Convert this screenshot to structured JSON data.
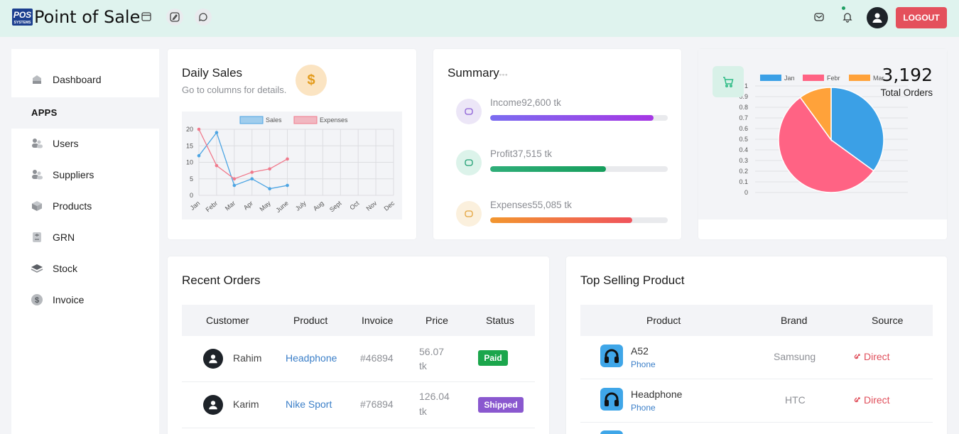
{
  "header": {
    "title": "Point of Sale",
    "logo_text": "POS",
    "logo_sub": "SYSTEMS",
    "logout_label": "LOGOUT",
    "icons": [
      "calendar-icon",
      "edit-icon",
      "chat-icon",
      "mail-icon",
      "bell-icon",
      "user-icon"
    ]
  },
  "sidebar": {
    "items": [
      {
        "label": "Dashboard",
        "icon": "dashboard-icon"
      },
      {
        "label": "Users",
        "icon": "users-icon"
      },
      {
        "label": "Suppliers",
        "icon": "suppliers-icon"
      },
      {
        "label": "Products",
        "icon": "box-icon"
      },
      {
        "label": "GRN",
        "icon": "grn-icon"
      },
      {
        "label": "Stock",
        "icon": "layers-icon"
      },
      {
        "label": "Invoice",
        "icon": "dollar-icon"
      }
    ],
    "section_title": "APPS"
  },
  "daily_sales": {
    "title": "Daily Sales",
    "subtitle": "Go to columns for details.",
    "badge_icon": "$"
  },
  "summary": {
    "title": "Summary",
    "items": [
      {
        "label": "Income",
        "value": "92,600 tk",
        "progress": 0.92,
        "color_from": "#7b6cf0",
        "color_to": "#a637e4",
        "icon_bg": "#ece6f7",
        "icon_color": "#8a5cd6"
      },
      {
        "label": "Profit",
        "value": "37,515 tk",
        "progress": 0.65,
        "color_from": "#2fae79",
        "color_to": "#169e5c",
        "icon_bg": "#dcf3ea",
        "icon_color": "#1f9e72"
      },
      {
        "label": "Expenses",
        "value": "55,085 tk",
        "progress": 0.8,
        "color_from": "#f2962e",
        "color_to": "#f0535c",
        "icon_bg": "#fbf0dd",
        "icon_color": "#e3a23a"
      }
    ]
  },
  "orders": {
    "total": "3,192",
    "label": "Total Orders"
  },
  "recent_orders": {
    "title": "Recent Orders",
    "columns": [
      "Customer",
      "Product",
      "Invoice",
      "Price",
      "Status"
    ],
    "rows": [
      {
        "customer": "Rahim",
        "product": "Headphone",
        "invoice": "#46894",
        "price_line1": "56.07",
        "price_line2": "tk",
        "status": "Paid",
        "status_color": "#1ba64c"
      },
      {
        "customer": "Karim",
        "product": "Nike Sport",
        "invoice": "#76894",
        "price_line1": "126.04",
        "price_line2": "tk",
        "status": "Shipped",
        "status_color": "#8a58cf"
      }
    ]
  },
  "top_selling": {
    "title": "Top Selling Product",
    "columns": [
      "Product",
      "Brand",
      "Source"
    ],
    "rows": [
      {
        "name": "A52",
        "category": "Phone",
        "brand": "Samsung",
        "source": "Direct"
      },
      {
        "name": "Headphone",
        "category": "Phone",
        "brand": "HTC",
        "source": "Direct"
      }
    ]
  },
  "chart_data": [
    {
      "type": "line",
      "categories": [
        "Jan",
        "Febr",
        "Mar",
        "Apr",
        "May",
        "June",
        "July",
        "Aug",
        "Sept",
        "Oct",
        "Nov",
        "Dec"
      ],
      "series": [
        {
          "name": "Sales",
          "values": [
            12,
            19,
            3,
            5,
            2,
            3
          ],
          "color": "#4da5e3"
        },
        {
          "name": "Expenses",
          "values": [
            20,
            9,
            5,
            7,
            8,
            11
          ],
          "color": "#f07a8c"
        }
      ],
      "yticks": [
        0,
        5,
        10,
        15,
        20
      ],
      "ylim": [
        0,
        20
      ],
      "grid": true,
      "legend": "top-center"
    },
    {
      "type": "pie",
      "labels": [
        "Jan",
        "Febr",
        "Mar"
      ],
      "values": [
        35,
        55,
        10
      ],
      "colors": [
        "#3ba0e6",
        "#ff6384",
        "#ffa23a"
      ],
      "yticks": [
        "0",
        "0.1",
        "0.2",
        "0.3",
        "0.4",
        "0.5",
        "0.6",
        "0.7",
        "0.8",
        "0.9",
        "1"
      ],
      "legend": "top"
    }
  ]
}
